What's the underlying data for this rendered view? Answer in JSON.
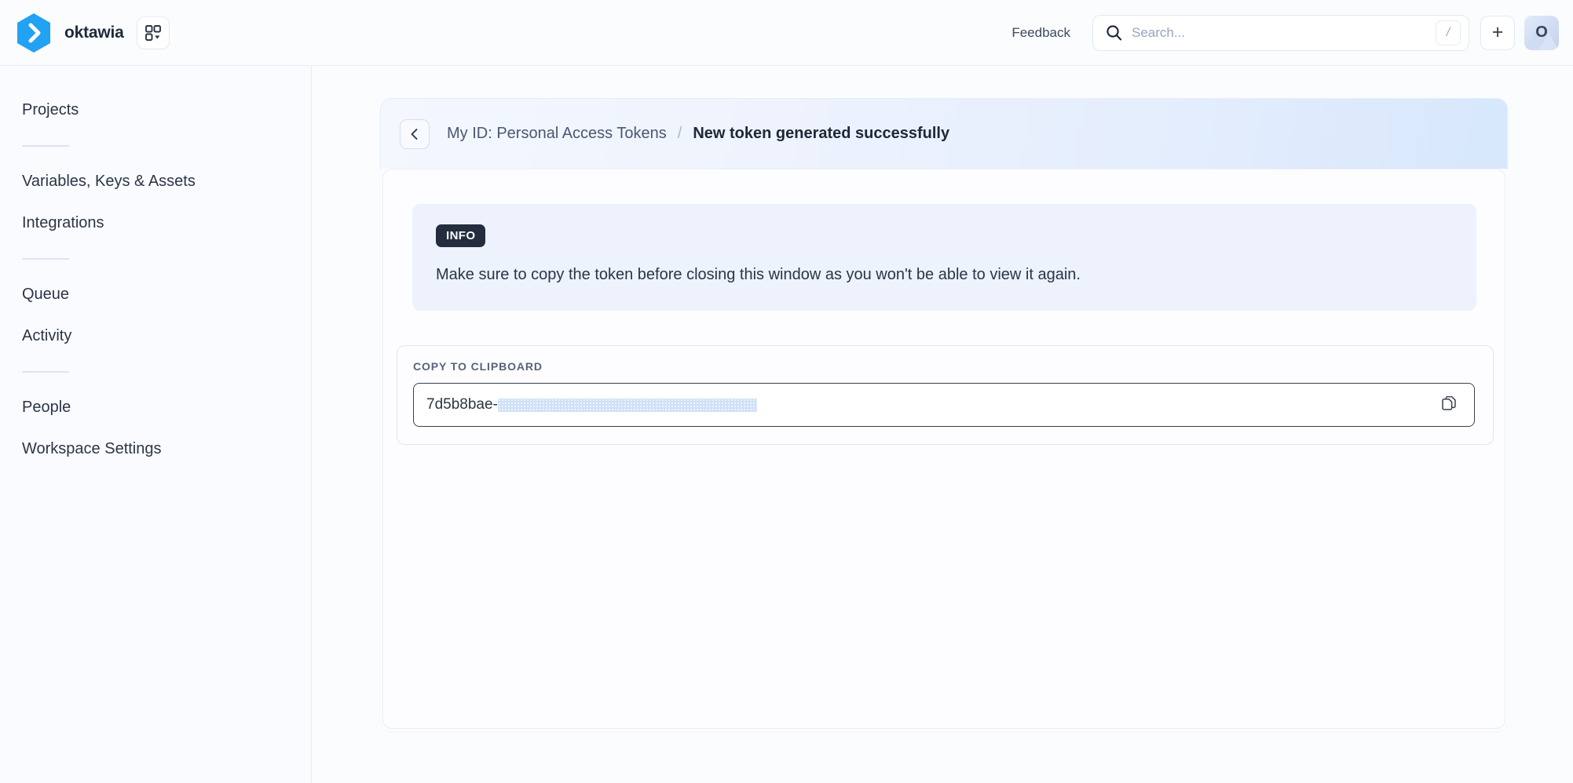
{
  "topbar": {
    "brand_name": "oktawia",
    "logo_icon": "chevron-right-hex-logo",
    "grid_switcher_icon": "grid-dropdown-icon",
    "feedback_label": "Feedback",
    "search": {
      "placeholder": "Search...",
      "value": "",
      "icon": "search-icon",
      "shortcut_badge": "/"
    },
    "add_button_label": "+",
    "avatar_initial": "O"
  },
  "sidebar": {
    "items": [
      {
        "label": "Projects",
        "type": "link"
      },
      {
        "type": "divider"
      },
      {
        "label": "Variables, Keys & Assets",
        "type": "link"
      },
      {
        "label": "Integrations",
        "type": "link"
      },
      {
        "type": "divider"
      },
      {
        "label": "Queue",
        "type": "link"
      },
      {
        "label": "Activity",
        "type": "link"
      },
      {
        "type": "divider"
      },
      {
        "label": "People",
        "type": "link"
      },
      {
        "label": "Workspace Settings",
        "type": "link"
      }
    ]
  },
  "breadcrumb": {
    "back_icon": "chevron-left-icon",
    "parent": "My ID: Personal Access Tokens",
    "separator": "/",
    "current": "New token generated successfully"
  },
  "info_banner": {
    "badge": "INFO",
    "message": "Make sure to copy the token before closing this window as you won't be able to view it again."
  },
  "copy_section": {
    "label": "COPY TO CLIPBOARD",
    "token_visible_prefix": "7d5b8bae-",
    "token_redacted": true,
    "copy_icon": "copy-icon"
  },
  "colors": {
    "brand_blue": "#2196f3",
    "accent_badge_dark": "#242d3d",
    "info_banner_bg": "#edf2fd",
    "page_bg": "#fbfcfe",
    "redaction_highlight": "#cfe0f7"
  }
}
